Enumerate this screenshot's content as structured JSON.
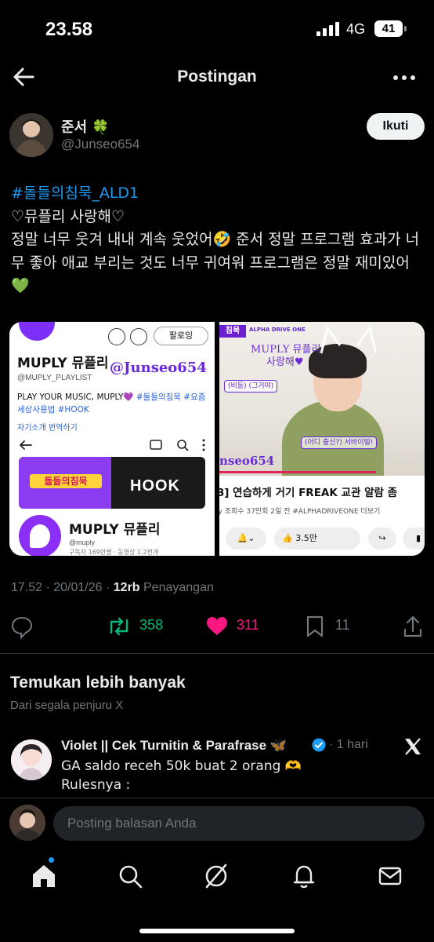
{
  "status_bar": {
    "time": "23.58",
    "network": "4G",
    "battery": "41"
  },
  "header": {
    "title": "Postingan"
  },
  "post": {
    "author_name": "준서",
    "author_emoji": "🍀",
    "author_handle": "@Junseo654",
    "follow_label": "Ikuti",
    "hashtag": "#돌들의침묵_ALD1",
    "line2": "♡뮤플리 사랑해♡",
    "line3a": "정말 너무 웃겨 내내 계속 웃었어",
    "emoji_rofl": "🤣",
    "line3b": " 준서 정말 프로그램 효과가 너무 좋아 애교 부리는 것도 너무 귀여워 프로그램은 정말 재미있어",
    "emoji_heart": "💚",
    "timestamp": "17.52 · 20/01/26 · ",
    "views_count": "12rb",
    "views_label": " Penayangan",
    "retweets": "358",
    "likes": "311",
    "bookmarks": "11"
  },
  "media_left": {
    "follow_btn": "팔로잉",
    "title": "MUPLY 뮤플리",
    "handle": "@MUPLY_PLAYLIST",
    "desc_a": "PLAY YOUR MUSIC, MUPLY💜 ",
    "desc_tags": "#돌들의침묵 #요즘세상사용법 #HOOK",
    "translate": "자기소개 번역하기",
    "watermark": "@Junseo654",
    "banner_badge": "돌들의침묵",
    "banner_hook": "HOOK",
    "name2": "MUPLY 뮤플리",
    "sub2": "@muply",
    "sub3": "구독자 169만명 · 동영상 1.2천개"
  },
  "media_right": {
    "channel_tag": "침묵",
    "alpha": "ALPHA DRIVE ONE",
    "overlay1a": "MUPLY 뮤플리",
    "overlay1b": "사랑해♥",
    "overlay2": "(비등) (그거야)",
    "overlay3": "(어디 출신?) 서바이벌!",
    "watermark": "nseo654",
    "video_title": "B] 연습하게 거기 FREAK 교관 알람 좀",
    "video_meta": "ly  조회수 37만회  2일 전  #ALPHADRIVEONE  더보기",
    "like_count": "3.5만"
  },
  "discover": {
    "title": "Temukan lebih banyak",
    "subtitle": "Dari segala penjuru X"
  },
  "feed_item": {
    "name": "Violet || Cek Turnitin & Parafrase",
    "name_emoji": "🦋",
    "time": "· 1 hari",
    "text1": "GA saldo receh 50k buat 2 orang 🫶",
    "text2": "Rulesnya :",
    "text3": "❤"
  },
  "reply_bar": {
    "placeholder": "Posting balasan Anda"
  },
  "colors": {
    "accent": "#1d9bf0",
    "retweet": "#00ba7c",
    "like": "#f91880",
    "muted": "#71767b"
  }
}
